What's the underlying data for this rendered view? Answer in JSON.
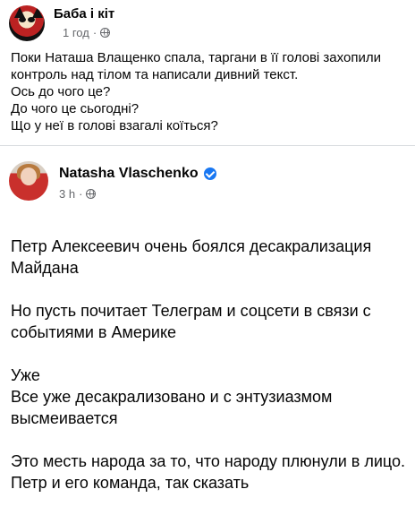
{
  "outer_post": {
    "author": "Баба і кіт",
    "time": "1 год",
    "separator": "·",
    "icon": "globe-icon",
    "lines": [
      "Поки Наташа Влащенко спала, таргани в її голові захопили",
      "контроль над тілом та написали дивний текст.",
      "Ось до чого це?",
      "До чого це сьогодні?",
      "Що у неї в голові взагалі коїться?"
    ]
  },
  "shared_post": {
    "author": "Natasha  Vlaschenko",
    "verified_icon": "verified-badge-icon",
    "time": "3 h",
    "separator": "·",
    "icon": "globe-icon",
    "paragraphs": [
      "Петр Алексеевич очень боялся десакрализация\nМайдана",
      "Но пусть почитает Телеграм и соцсети в связи с\nсобытиями в Америке",
      "Уже\nВсе уже десакрализовано и с энтузиазмом\nвысмеивается",
      "Это месть народа за то, что народу плюнули в лицо.\nПетр и его команда, так сказать"
    ]
  },
  "colors": {
    "text": "#050505",
    "meta": "#65676b",
    "verified": "#1877f2",
    "divider": "#dadde1"
  }
}
